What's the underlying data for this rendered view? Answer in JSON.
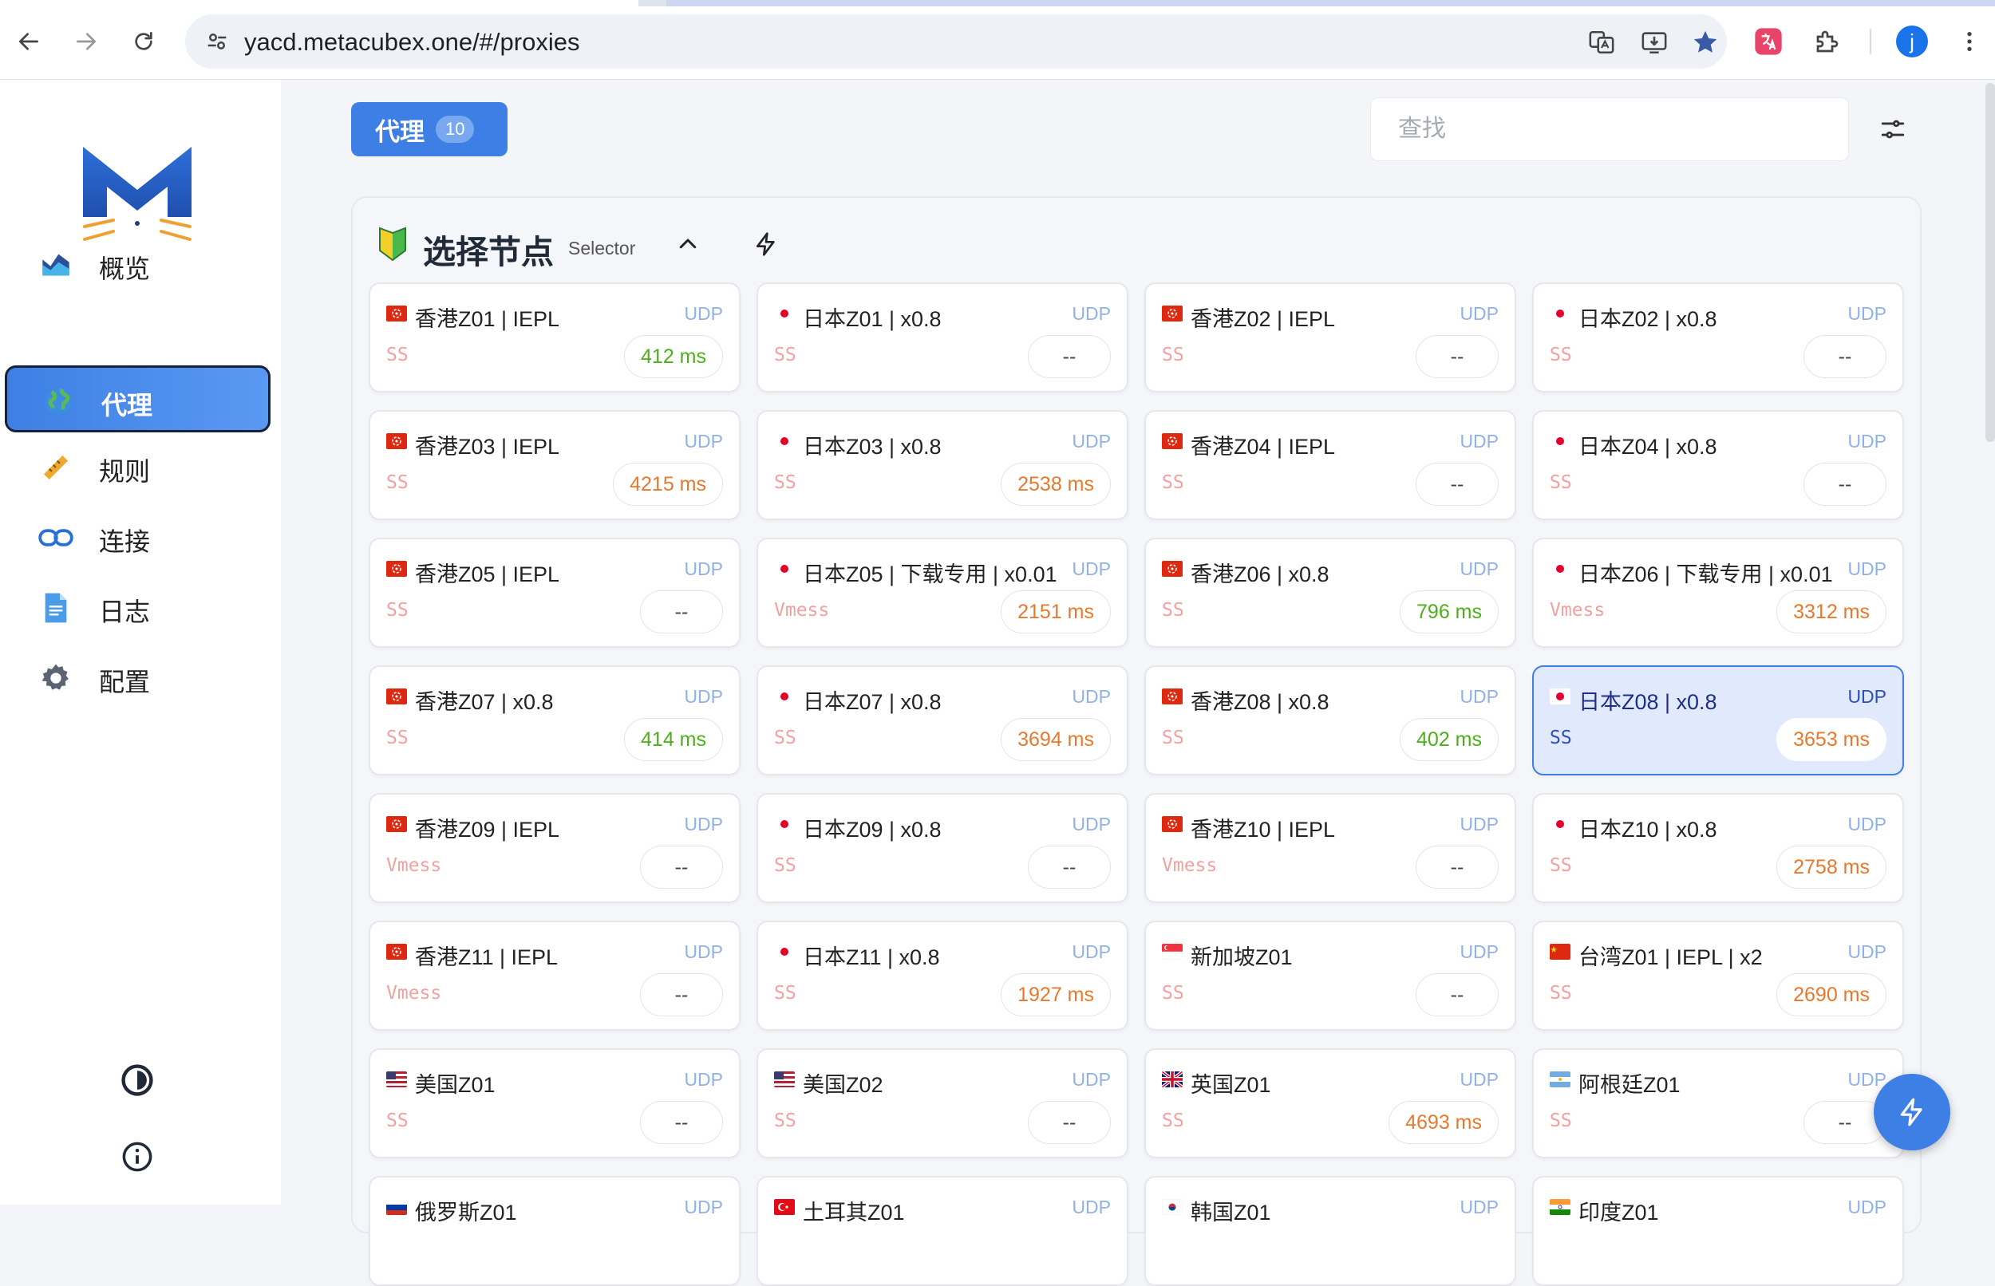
{
  "browser": {
    "url": "yacd.metacubex.one/#/proxies",
    "profile_initial": "j"
  },
  "sidebar": {
    "items": [
      {
        "label": "概览",
        "icon": "chart-icon"
      },
      {
        "label": "代理",
        "icon": "globe-icon",
        "active": true
      },
      {
        "label": "规则",
        "icon": "ruler-icon"
      },
      {
        "label": "连接",
        "icon": "link-icon"
      },
      {
        "label": "日志",
        "icon": "document-icon"
      },
      {
        "label": "配置",
        "icon": "gear-icon"
      }
    ]
  },
  "header": {
    "tab_label": "代理",
    "tab_count": "10",
    "search_placeholder": "查找"
  },
  "group": {
    "name": "选择节点",
    "type": "Selector"
  },
  "colors": {
    "accent": "#3d7fe4",
    "latency_good": "#4caf1a",
    "latency_slow": "#e8792c"
  },
  "proxies": [
    {
      "flag": "hk",
      "name": "香港Z01 | IEPL",
      "udp": "UDP",
      "type": "SS",
      "latency": "412 ms",
      "speed": "good"
    },
    {
      "flag": "jp",
      "name": "日本Z01 | x0.8",
      "udp": "UDP",
      "type": "SS",
      "latency": "--",
      "speed": "none"
    },
    {
      "flag": "hk",
      "name": "香港Z02 | IEPL",
      "udp": "UDP",
      "type": "SS",
      "latency": "--",
      "speed": "none"
    },
    {
      "flag": "jp",
      "name": "日本Z02 | x0.8",
      "udp": "UDP",
      "type": "SS",
      "latency": "--",
      "speed": "none"
    },
    {
      "flag": "hk",
      "name": "香港Z03 | IEPL",
      "udp": "UDP",
      "type": "SS",
      "latency": "4215 ms",
      "speed": "slow"
    },
    {
      "flag": "jp",
      "name": "日本Z03 | x0.8",
      "udp": "UDP",
      "type": "SS",
      "latency": "2538 ms",
      "speed": "slow"
    },
    {
      "flag": "hk",
      "name": "香港Z04 | IEPL",
      "udp": "UDP",
      "type": "SS",
      "latency": "--",
      "speed": "none"
    },
    {
      "flag": "jp",
      "name": "日本Z04 | x0.8",
      "udp": "UDP",
      "type": "SS",
      "latency": "--",
      "speed": "none"
    },
    {
      "flag": "hk",
      "name": "香港Z05 | IEPL",
      "udp": "UDP",
      "type": "SS",
      "latency": "--",
      "speed": "none"
    },
    {
      "flag": "jp",
      "name": "日本Z05 | 下载专用 | x0.01",
      "udp": "UDP",
      "type": "Vmess",
      "latency": "2151 ms",
      "speed": "slow"
    },
    {
      "flag": "hk",
      "name": "香港Z06 | x0.8",
      "udp": "UDP",
      "type": "SS",
      "latency": "796 ms",
      "speed": "good"
    },
    {
      "flag": "jp",
      "name": "日本Z06 | 下载专用 | x0.01",
      "udp": "UDP",
      "type": "Vmess",
      "latency": "3312 ms",
      "speed": "slow"
    },
    {
      "flag": "hk",
      "name": "香港Z07 | x0.8",
      "udp": "UDP",
      "type": "SS",
      "latency": "414 ms",
      "speed": "good"
    },
    {
      "flag": "jp",
      "name": "日本Z07 | x0.8",
      "udp": "UDP",
      "type": "SS",
      "latency": "3694 ms",
      "speed": "slow"
    },
    {
      "flag": "hk",
      "name": "香港Z08 | x0.8",
      "udp": "UDP",
      "type": "SS",
      "latency": "402 ms",
      "speed": "good"
    },
    {
      "flag": "jp",
      "name": "日本Z08 | x0.8",
      "udp": "UDP",
      "type": "SS",
      "latency": "3653 ms",
      "speed": "slow",
      "selected": true
    },
    {
      "flag": "hk",
      "name": "香港Z09 | IEPL",
      "udp": "UDP",
      "type": "Vmess",
      "latency": "--",
      "speed": "none"
    },
    {
      "flag": "jp",
      "name": "日本Z09 | x0.8",
      "udp": "UDP",
      "type": "SS",
      "latency": "--",
      "speed": "none"
    },
    {
      "flag": "hk",
      "name": "香港Z10 | IEPL",
      "udp": "UDP",
      "type": "Vmess",
      "latency": "--",
      "speed": "none"
    },
    {
      "flag": "jp",
      "name": "日本Z10 | x0.8",
      "udp": "UDP",
      "type": "SS",
      "latency": "2758 ms",
      "speed": "slow"
    },
    {
      "flag": "hk",
      "name": "香港Z11 | IEPL",
      "udp": "UDP",
      "type": "Vmess",
      "latency": "--",
      "speed": "none"
    },
    {
      "flag": "jp",
      "name": "日本Z11 | x0.8",
      "udp": "UDP",
      "type": "SS",
      "latency": "1927 ms",
      "speed": "slow"
    },
    {
      "flag": "sg",
      "name": "新加坡Z01",
      "udp": "UDP",
      "type": "SS",
      "latency": "--",
      "speed": "none"
    },
    {
      "flag": "cn",
      "name": "台湾Z01 | IEPL | x2",
      "udp": "UDP",
      "type": "SS",
      "latency": "2690 ms",
      "speed": "slow"
    },
    {
      "flag": "us",
      "name": "美国Z01",
      "udp": "UDP",
      "type": "SS",
      "latency": "--",
      "speed": "none"
    },
    {
      "flag": "us",
      "name": "美国Z02",
      "udp": "UDP",
      "type": "SS",
      "latency": "--",
      "speed": "none"
    },
    {
      "flag": "gb",
      "name": "英国Z01",
      "udp": "UDP",
      "type": "SS",
      "latency": "4693 ms",
      "speed": "slow"
    },
    {
      "flag": "ar",
      "name": "阿根廷Z01",
      "udp": "UDP",
      "type": "SS",
      "latency": "--",
      "speed": "none"
    },
    {
      "flag": "ru",
      "name": "俄罗斯Z01",
      "udp": "UDP",
      "type": "",
      "latency": "",
      "speed": "none"
    },
    {
      "flag": "tr",
      "name": "土耳其Z01",
      "udp": "UDP",
      "type": "",
      "latency": "",
      "speed": "none"
    },
    {
      "flag": "kr",
      "name": "韩国Z01",
      "udp": "UDP",
      "type": "",
      "latency": "",
      "speed": "none"
    },
    {
      "flag": "in",
      "name": "印度Z01",
      "udp": "UDP",
      "type": "",
      "latency": "",
      "speed": "none"
    }
  ]
}
